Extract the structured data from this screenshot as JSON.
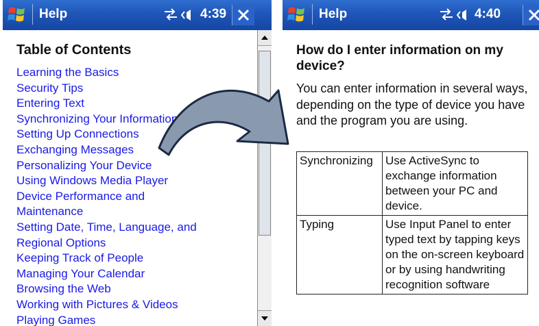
{
  "left_screen": {
    "title": "Help",
    "time": "4:39",
    "toc_heading": "Table of Contents",
    "toc_items": [
      "Learning the Basics",
      "Security Tips",
      "Entering Text",
      "Synchronizing Your Information",
      "Setting Up Connections",
      "Exchanging Messages",
      "Personalizing Your Device",
      "Using Windows Media Player",
      "Device Performance and",
      "Maintenance",
      "Setting Date, Time, Language, and",
      "Regional Options",
      "Keeping Track of People",
      "Managing Your Calendar",
      "Browsing the Web",
      "Working with Pictures & Videos",
      "Playing Games"
    ]
  },
  "right_screen": {
    "title": "Help",
    "time": "4:40",
    "heading": "How do I enter information on my device?",
    "intro": "You can enter information in several ways, depending on the type of device you have and the program you are using.",
    "table_rows": [
      [
        "Synchronizing",
        "Use ActiveSync to exchange information between your PC and device."
      ],
      [
        "Typing",
        "Use Input Panel to enter typed text by tapping keys on the on-screen keyboard or by using handwriting recognition software"
      ]
    ]
  },
  "icons": {
    "start": "windows-flag-icon",
    "connectivity": "sync-arrows-icon",
    "volume": "speaker-icon",
    "close": "close-icon",
    "transition": "curved-arrow-icon"
  },
  "colors": {
    "titlebar": "#1f56b8",
    "link": "#1a1ae6",
    "arrow_fill": "#8a9aae"
  }
}
